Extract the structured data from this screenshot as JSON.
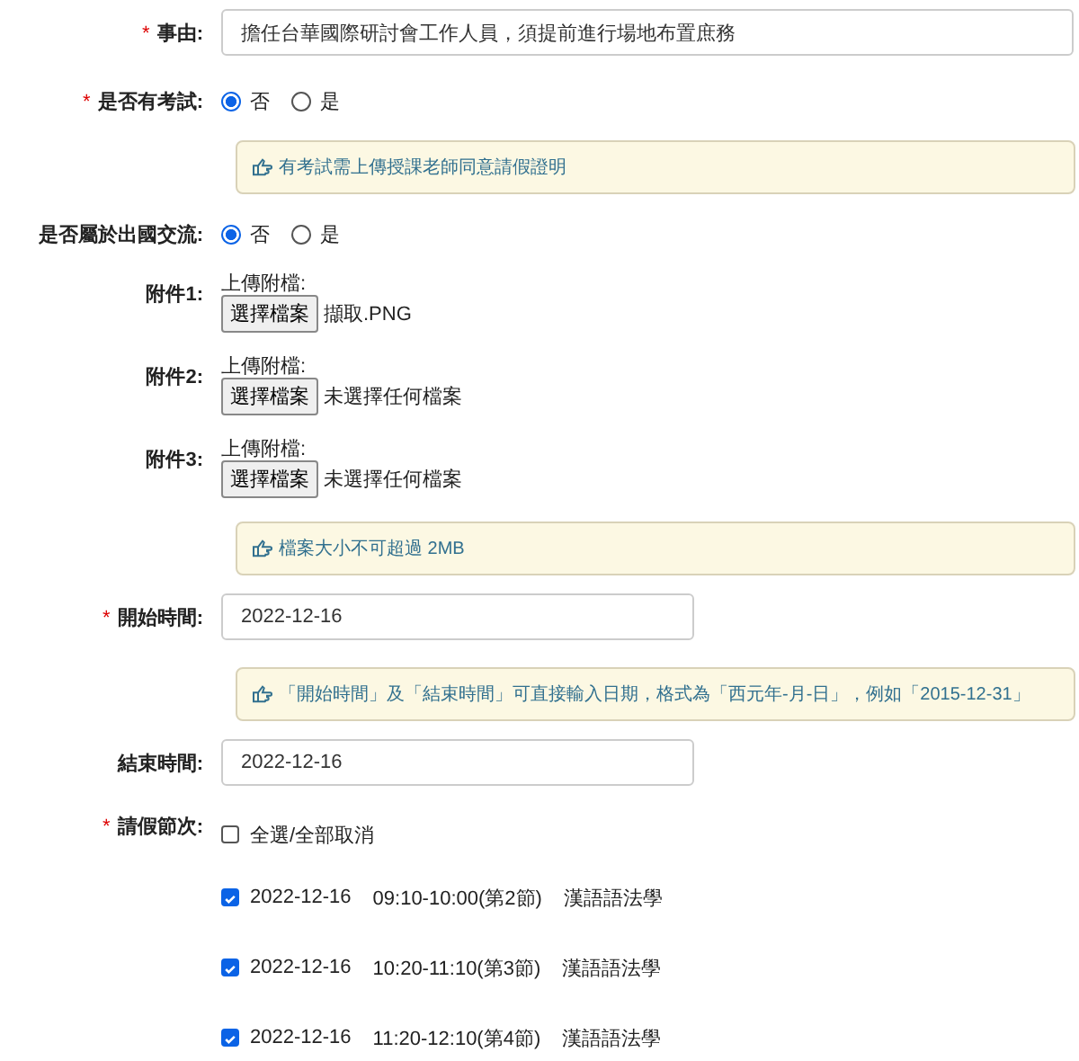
{
  "rows": [
    {
      "kind": "text",
      "label": "事由:",
      "marker": "*",
      "value": "擔任台華國際研討會工作人員，須提前進行場地布置庶務"
    },
    {
      "kind": "radio",
      "label": "是否有考試:",
      "marker": "*",
      "options": [
        {
          "label": "否",
          "selected": true
        },
        {
          "label": "是",
          "selected": false
        }
      ]
    },
    {
      "kind": "notice",
      "text": "有考試需上傳授課老師同意請假證明"
    },
    {
      "kind": "radio",
      "label": "是否屬於出國交流:",
      "options": [
        {
          "label": "否",
          "selected": true
        },
        {
          "label": "是",
          "selected": false
        }
      ]
    },
    {
      "kind": "file",
      "label": "附件1:",
      "caption": "上傳附檔:",
      "button": "選擇檔案",
      "file": "擷取.PNG"
    },
    {
      "kind": "file",
      "label": "附件2:",
      "caption": "上傳附檔:",
      "button": "選擇檔案",
      "file": "未選擇任何檔案"
    },
    {
      "kind": "file",
      "label": "附件3:",
      "caption": "上傳附檔:",
      "button": "選擇檔案",
      "file": "未選擇任何檔案"
    },
    {
      "kind": "notice",
      "text": "檔案大小不可超過 2MB"
    },
    {
      "kind": "date",
      "label": "開始時間:",
      "marker": "*",
      "value": "2022-12-16"
    },
    {
      "kind": "notice",
      "text": "「開始時間」及「結束時間」可直接輸入日期，格式為「西元年-月-日」，例如「2015-12-31」"
    },
    {
      "kind": "date",
      "label": "結束時間:",
      "value": "2022-12-16"
    },
    {
      "kind": "periods",
      "label": "請假節次:",
      "marker": "*",
      "select_all": {
        "label": "全選/全部取消",
        "checked": false
      },
      "items": [
        {
          "date": "2022-12-16",
          "time": "09:10-10:00(第2節)",
          "course": "漢語語法學",
          "checked": true
        },
        {
          "date": "2022-12-16",
          "time": "10:20-11:10(第3節)",
          "course": "漢語語法學",
          "checked": true
        },
        {
          "date": "2022-12-16",
          "time": "11:20-12:10(第4節)",
          "course": "漢語語法學",
          "checked": true
        }
      ]
    }
  ]
}
